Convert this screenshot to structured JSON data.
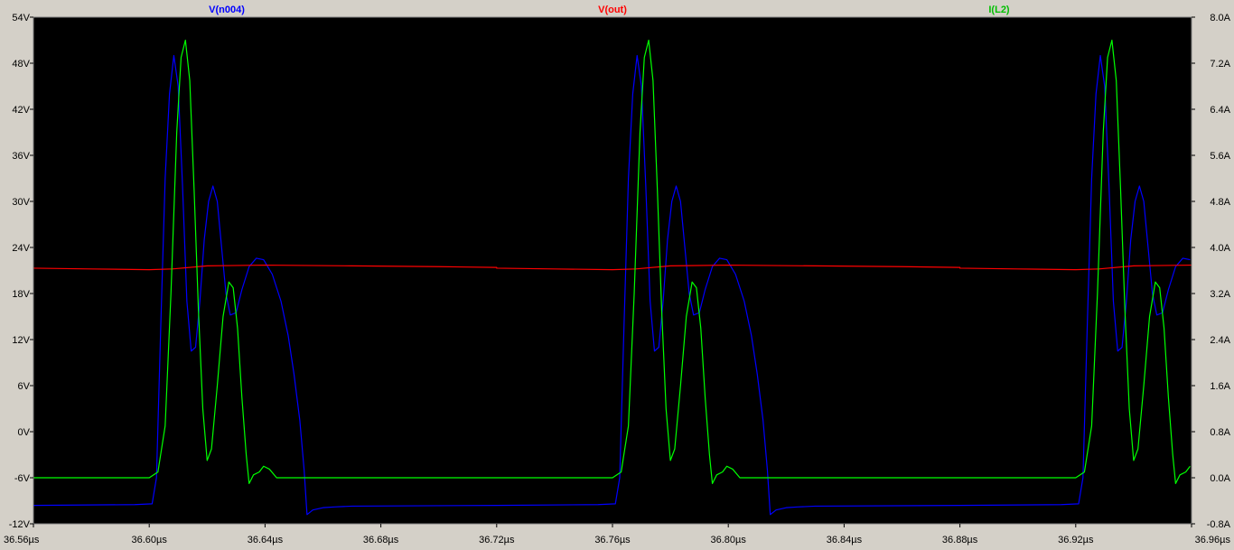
{
  "chart_data": {
    "type": "line",
    "x_axis": {
      "range": [
        36.56,
        36.96
      ],
      "unit": "µs",
      "ticks": [
        36.56,
        36.6,
        36.64,
        36.68,
        36.72,
        36.76,
        36.8,
        36.84,
        36.88,
        36.92,
        36.96
      ],
      "tick_labels": [
        "36.56µs",
        "36.60µs",
        "36.64µs",
        "36.68µs",
        "36.72µs",
        "36.76µs",
        "36.80µs",
        "36.84µs",
        "36.88µs",
        "36.92µs",
        "36.96µs"
      ]
    },
    "y_left": {
      "range": [
        -12,
        54
      ],
      "unit": "V",
      "ticks": [
        -12,
        -6,
        0,
        6,
        12,
        18,
        24,
        30,
        36,
        42,
        48,
        54
      ],
      "tick_labels": [
        "-12V",
        "-6V",
        "0V",
        "6V",
        "12V",
        "18V",
        "24V",
        "30V",
        "36V",
        "42V",
        "48V",
        "54V"
      ]
    },
    "y_right": {
      "range": [
        -0.8,
        8.0
      ],
      "unit": "A",
      "ticks": [
        -0.8,
        0.0,
        0.8,
        1.6,
        2.4,
        3.2,
        4.0,
        4.8,
        5.6,
        6.4,
        7.2,
        8.0
      ],
      "tick_labels": [
        "-0.8A",
        "0.0A",
        "0.8A",
        "1.6A",
        "2.4A",
        "3.2A",
        "4.0A",
        "4.8A",
        "5.6A",
        "6.4A",
        "7.2A",
        "8.0A"
      ]
    },
    "grid": false,
    "background": "#000000",
    "period": 0.16,
    "series": [
      {
        "name": "V(n004)",
        "axis": "left",
        "color": "#0000ff",
        "points": [
          [
            36.56,
            -9.6
          ],
          [
            36.595,
            -9.5
          ],
          [
            36.601,
            -9.4
          ],
          [
            36.6025,
            -6
          ],
          [
            36.604,
            14
          ],
          [
            36.6055,
            33
          ],
          [
            36.607,
            44
          ],
          [
            36.6085,
            49
          ],
          [
            36.61,
            45
          ],
          [
            36.6115,
            32
          ],
          [
            36.613,
            17
          ],
          [
            36.6145,
            10.5
          ],
          [
            36.616,
            11
          ],
          [
            36.6175,
            17
          ],
          [
            36.619,
            25
          ],
          [
            36.6205,
            30
          ],
          [
            36.622,
            32
          ],
          [
            36.6235,
            30
          ],
          [
            36.625,
            24
          ],
          [
            36.6265,
            18
          ],
          [
            36.628,
            15.2
          ],
          [
            36.63,
            15.5
          ],
          [
            36.632,
            18.5
          ],
          [
            36.6345,
            21.5
          ],
          [
            36.637,
            22.6
          ],
          [
            36.6395,
            22.4
          ],
          [
            36.6425,
            20.5
          ],
          [
            36.6455,
            17
          ],
          [
            36.648,
            12.5
          ],
          [
            36.65,
            7.5
          ],
          [
            36.652,
            1.5
          ],
          [
            36.6535,
            -5
          ],
          [
            36.6545,
            -10.8
          ],
          [
            36.6565,
            -10.2
          ],
          [
            36.66,
            -9.9
          ],
          [
            36.664,
            -9.8
          ],
          [
            36.67,
            -9.7
          ]
        ]
      },
      {
        "name": "V(out)",
        "axis": "left",
        "color": "#ff0000",
        "points": [
          [
            36.56,
            21.3
          ],
          [
            36.58,
            21.2
          ],
          [
            36.6,
            21.1
          ],
          [
            36.608,
            21.2
          ],
          [
            36.62,
            21.6
          ],
          [
            36.64,
            21.7
          ],
          [
            36.67,
            21.6
          ],
          [
            36.7,
            21.5
          ],
          [
            36.72,
            21.4
          ]
        ]
      },
      {
        "name": "I(L2)",
        "axis": "right",
        "color": "#00ff00",
        "points": [
          [
            36.56,
            0.0
          ],
          [
            36.6,
            0.0
          ],
          [
            36.603,
            0.1
          ],
          [
            36.6055,
            0.9
          ],
          [
            36.6075,
            3.2
          ],
          [
            36.6095,
            6.0
          ],
          [
            36.611,
            7.3
          ],
          [
            36.6125,
            7.6
          ],
          [
            36.614,
            6.9
          ],
          [
            36.6155,
            5.0
          ],
          [
            36.617,
            2.9
          ],
          [
            36.6185,
            1.2
          ],
          [
            36.62,
            0.3
          ],
          [
            36.6215,
            0.5
          ],
          [
            36.6235,
            1.6
          ],
          [
            36.6255,
            2.8
          ],
          [
            36.6275,
            3.4
          ],
          [
            36.629,
            3.3
          ],
          [
            36.6305,
            2.6
          ],
          [
            36.632,
            1.4
          ],
          [
            36.6335,
            0.4
          ],
          [
            36.6345,
            -0.1
          ],
          [
            36.636,
            0.05
          ],
          [
            36.638,
            0.1
          ],
          [
            36.6395,
            0.2
          ],
          [
            36.6415,
            0.15
          ],
          [
            36.644,
            0.0
          ],
          [
            36.647,
            0.0
          ],
          [
            36.67,
            0.0
          ],
          [
            36.72,
            0.0
          ]
        ]
      }
    ]
  }
}
